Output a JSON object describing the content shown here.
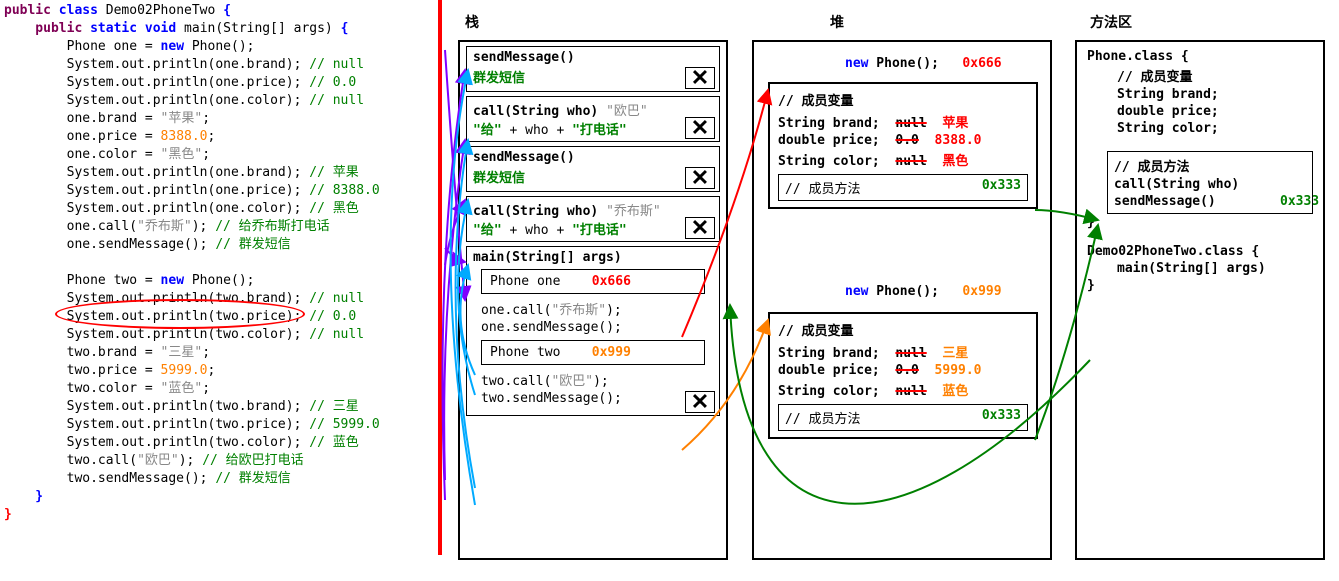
{
  "code": {
    "l1a": "public",
    "l1b": " class",
    "l1c": " Demo02PhoneTwo ",
    "l1d": "{",
    "l2a": "    public",
    "l2b": " static",
    "l2c": " void",
    "l2d": " main(String[] args) ",
    "l2e": "{",
    "l3a": "        Phone one = ",
    "l3b": "new",
    "l3c": " Phone();",
    "l4a": "        System.out.println(one.brand); ",
    "l4b": "// null",
    "l5a": "        System.out.println(one.price); ",
    "l5b": "// 0.0",
    "l6a": "        System.out.println(one.color); ",
    "l6b": "// null",
    "l7a": "        one.brand = ",
    "l7b": "\"苹果\"",
    "l7c": ";",
    "l8a": "        one.price = ",
    "l8b": "8388.0",
    "l8c": ";",
    "l9a": "        one.color = ",
    "l9b": "\"黑色\"",
    "l9c": ";",
    "l10a": "        System.out.println(one.brand); ",
    "l10b": "// 苹果",
    "l11a": "        System.out.println(one.price); ",
    "l11b": "// 8388.0",
    "l12a": "        System.out.println(one.color); ",
    "l12b": "// 黑色",
    "l13a": "        one.call(",
    "l13b": "\"乔布斯\"",
    "l13c": "); ",
    "l13d": "// 给乔布斯打电话",
    "l14a": "        one.sendMessage(); ",
    "l14b": "// 群发短信",
    "l15": "",
    "l16a": "        Phone two = ",
    "l16b": "new",
    "l16c": " Phone();",
    "l17a": "        System.out.println(two.brand); ",
    "l17b": "// null",
    "l18a": "        System.out.println(two.price); ",
    "l18b": "// 0.0",
    "l19a": "        System.out.println(two.color); ",
    "l19b": "// null",
    "l20a": "        two.brand = ",
    "l20b": "\"三星\"",
    "l20c": ";",
    "l21a": "        two.price = ",
    "l21b": "5999.0",
    "l21c": ";",
    "l22a": "        two.color = ",
    "l22b": "\"蓝色\"",
    "l22c": ";",
    "l23a": "        System.out.println(two.brand); ",
    "l23b": "// 三星",
    "l24a": "        System.out.println(two.price); ",
    "l24b": "// 5999.0",
    "l25a": "        System.out.println(two.color); ",
    "l25b": "// 蓝色",
    "l26a": "        two.call(",
    "l26b": "\"欧巴\"",
    "l26c": "); ",
    "l26d": "// 给欧巴打电话",
    "l27a": "        two.sendMessage(); ",
    "l27b": "// 群发短信",
    "l28": "    }",
    "l29": "}"
  },
  "labels": {
    "stack": "栈",
    "heap": "堆",
    "methodArea": "方法区"
  },
  "stack": {
    "f1t": "sendMessage()",
    "f1b": "群发短信",
    "f2t": "call(String who)",
    "f2p": "\"欧巴\"",
    "f2b1": "\"给\"",
    "f2b2": " + who + ",
    "f2b3": "\"打电话\"",
    "f3t": "sendMessage()",
    "f3b": "群发短信",
    "f4t": "call(String who)",
    "f4p": "\"乔布斯\"",
    "f4b1": "\"给\"",
    "f4b2": " + who + ",
    "f4b3": "\"打电话\"",
    "main_t": "main(String[] args)",
    "var1a": "Phone one",
    "var1b": "0x666",
    "call1": "one.call(",
    "call1p": "\"乔布斯\"",
    "call1e": ");",
    "call2": "one.sendMessage();",
    "var2a": "Phone two",
    "var2b": "0x999",
    "call3": "two.call(",
    "call3p": "\"欧巴\"",
    "call3e": ");",
    "call4": "two.sendMessage();"
  },
  "heap": {
    "new_kw": "new",
    "new_call": " Phone();",
    "addr1": "0x666",
    "addr2": "0x999",
    "members_label": "// 成员变量",
    "r1": "String brand;",
    "r1old": "null",
    "r1new": "苹果",
    "r2": "double price;",
    "r2old": "0.0",
    "r2new": "8388.0",
    "r3": "String color;",
    "r3old": "null",
    "r3new": "黑色",
    "r4new": "三星",
    "r5new": "5999.0",
    "r6new": "蓝色",
    "methods_label": "// 成员方法",
    "methods_addr": "0x333"
  },
  "marea": {
    "c1": "Phone.class {",
    "c1a": "// 成员变量",
    "c1b": "String brand;",
    "c1c": "double price;",
    "c1d": "String color;",
    "addr333": "0x333",
    "c1e": "// 成员方法",
    "c1f": "call(String who)",
    "c1g": "sendMessage()",
    "c1end": "}",
    "c2": "Demo02PhoneTwo.class {",
    "c2a": "main(String[] args)",
    "c2end": "}"
  }
}
